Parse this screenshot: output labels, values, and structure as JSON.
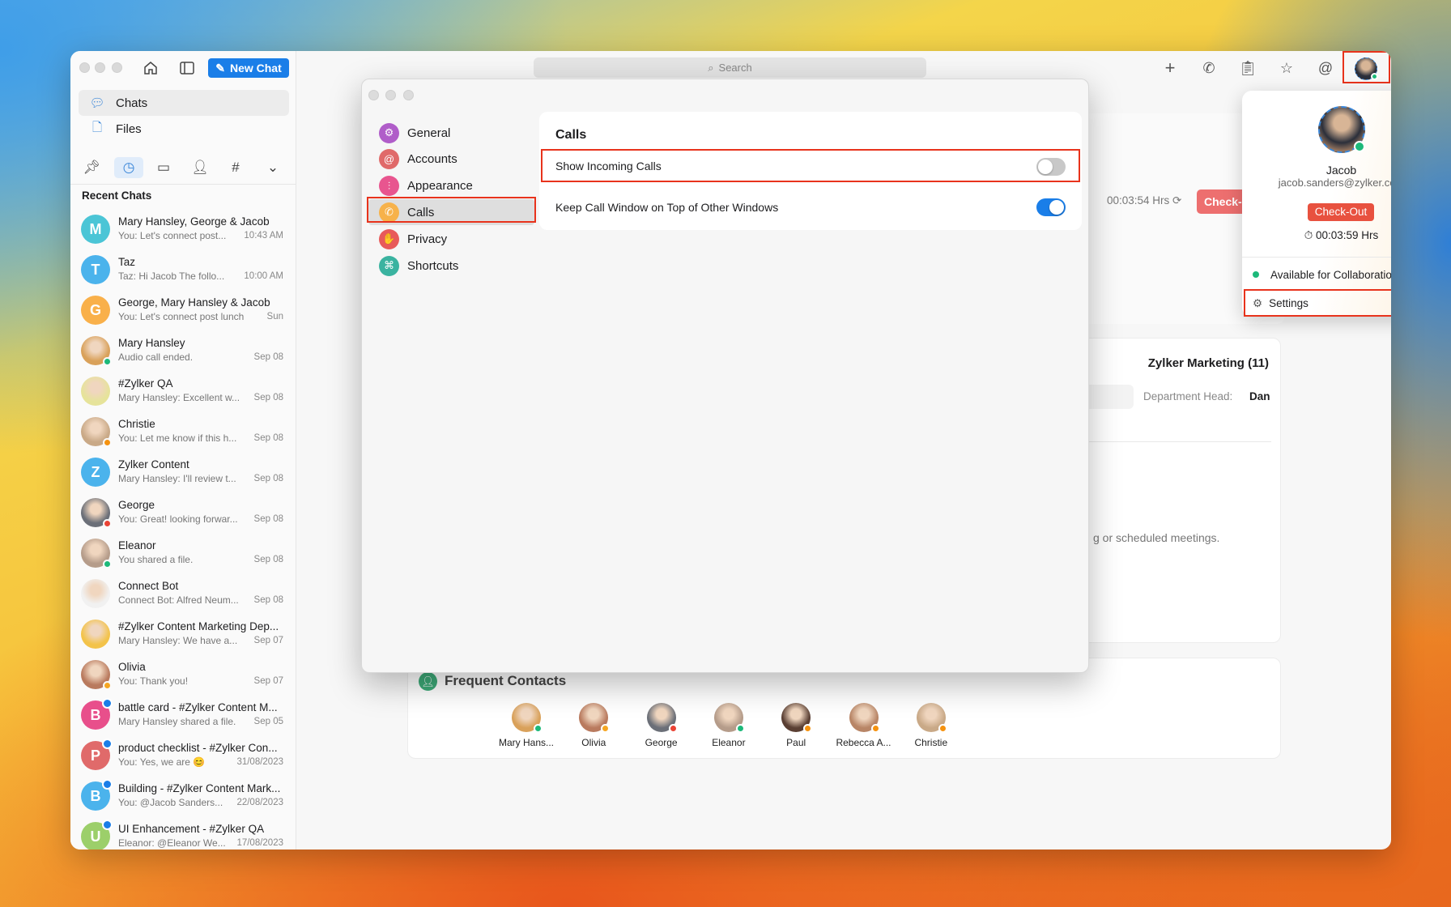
{
  "toolbar": {
    "new_chat": "New Chat",
    "search_placeholder": "Search"
  },
  "sidebar": {
    "nav": [
      {
        "label": "Chats",
        "icon": "chat-bubble-icon"
      },
      {
        "label": "Files",
        "icon": "file-icon"
      }
    ],
    "filters": [
      "pin-icon",
      "clock-icon",
      "chat-unread-icon",
      "contact-icon",
      "channel-hash-icon",
      "more-chevron-icon"
    ],
    "section_title": "Recent Chats",
    "chats": [
      {
        "name": "Mary Hansley, George & Jacob",
        "msg": "You: Let's connect post...",
        "time": "10:43 AM",
        "initial": "M",
        "color": "#4bc5d6"
      },
      {
        "name": "Taz",
        "msg": "Taz: Hi Jacob The follo...",
        "time": "10:00 AM",
        "initial": "T",
        "color": "#4bb3ec"
      },
      {
        "name": "George, Mary Hansley & Jacob",
        "msg": "You: Let's connect post lunch",
        "time": "Sun",
        "initial": "G",
        "color": "#f9b04a"
      },
      {
        "name": "Mary Hansley",
        "msg": "Audio call ended.",
        "time": "Sep 08",
        "photo": "#d9a15a",
        "status": "#1db97a"
      },
      {
        "name": "#Zylker QA",
        "msg": "Mary Hansley: Excellent w...",
        "time": "Sep 08",
        "photo": "#e6e39a"
      },
      {
        "name": "Christie",
        "msg": "You: Let me know if this h...",
        "time": "Sep 08",
        "photo": "#c9a987",
        "status": "#f5920f"
      },
      {
        "name": "Zylker Content",
        "msg": "Mary Hansley: I'll review t...",
        "time": "Sep 08",
        "initial": "Z",
        "color": "#4bb3ec"
      },
      {
        "name": "George",
        "msg": "You: Great! looking forwar...",
        "time": "Sep 08",
        "photo": "#6b6f78",
        "status": "#ea4335"
      },
      {
        "name": "Eleanor",
        "msg": "You shared a file.",
        "time": "Sep 08",
        "photo": "#b59c8a",
        "status": "#1db97a"
      },
      {
        "name": "Connect Bot",
        "msg": "Connect Bot: Alfred Neum...",
        "time": "Sep 08",
        "photo": "#f1f1f1"
      },
      {
        "name": "#Zylker Content Marketing Dep...",
        "msg": "Mary Hansley: We have a...",
        "time": "Sep 07",
        "photo": "#f3c34a"
      },
      {
        "name": "Olivia",
        "msg": "You: Thank you!",
        "time": "Sep 07",
        "photo": "#b97a5e",
        "status": "#f5a623"
      },
      {
        "name": "battle card - #Zylker Content M...",
        "msg": "Mary Hansley shared a file.",
        "time": "Sep 05",
        "initial": "B",
        "color": "#e84f8b",
        "badge": true
      },
      {
        "name": "product checklist - #Zylker Con...",
        "msg": "You: Yes, we are 😊",
        "time": "31/08/2023",
        "initial": "P",
        "color": "#e06a6a",
        "badge": true
      },
      {
        "name": "Building - #Zylker Content Mark...",
        "msg": "You: @Jacob Sanders...",
        "time": "22/08/2023",
        "initial": "B",
        "color": "#4bb3ec",
        "badge": true
      },
      {
        "name": "UI Enhancement - #Zylker QA",
        "msg": "Eleanor: @Eleanor We...",
        "time": "17/08/2023",
        "initial": "U",
        "color": "#9ccf6a",
        "badge": true
      }
    ]
  },
  "header_icons": [
    "plus-icon",
    "phone-icon",
    "clipboard-clock-icon",
    "star-icon",
    "mention-icon"
  ],
  "main": {
    "timer": "00:03:54 Hrs",
    "check_out": "Check-Out",
    "department": "Zylker Marketing (11)",
    "department_head_label": "Department Head:",
    "department_head_value": "Dan",
    "meetings_text": "g or scheduled meetings.",
    "frequent_title": "Frequent Contacts",
    "contacts": [
      {
        "name": "Mary Hans...",
        "photo": "#d9a15a",
        "status": "#1db97a"
      },
      {
        "name": "Olivia",
        "photo": "#b97a5e",
        "status": "#f5a623"
      },
      {
        "name": "George",
        "photo": "#6b6f78",
        "status": "#ea4335"
      },
      {
        "name": "Eleanor",
        "photo": "#b59c8a",
        "status": "#1db97a"
      },
      {
        "name": "Paul",
        "photo": "#5a3f33",
        "status": "#f5920f"
      },
      {
        "name": "Rebecca A...",
        "photo": "#b88566",
        "status": "#f5920f"
      },
      {
        "name": "Christie",
        "photo": "#c9a987",
        "status": "#f5920f"
      }
    ]
  },
  "settings": {
    "nav": [
      {
        "label": "General",
        "color": "#b05dc9",
        "glyph": "⚙"
      },
      {
        "label": "Accounts",
        "color": "#e06a6a",
        "glyph": "@"
      },
      {
        "label": "Appearance",
        "color": "#e8558f",
        "glyph": "⫶"
      },
      {
        "label": "Calls",
        "color": "#f7b24a",
        "glyph": "✆",
        "selected": true
      },
      {
        "label": "Privacy",
        "color": "#e85a5a",
        "glyph": "✋"
      },
      {
        "label": "Shortcuts",
        "color": "#3ab3a0",
        "glyph": "⌘"
      }
    ],
    "section_title": "Calls",
    "options": [
      {
        "label": "Show Incoming Calls",
        "on": false
      },
      {
        "label": "Keep Call Window on Top of Other Windows",
        "on": true
      }
    ]
  },
  "profile": {
    "name": "Jacob",
    "email": "jacob.sanders@zylker.com",
    "check_out": "Check-Out",
    "timer": "00:03:59 Hrs",
    "status": "Available for Collaboration",
    "status_color": "#1db97a",
    "settings": "Settings"
  },
  "colors": {
    "accent": "#1a7ee8",
    "danger": "#e8513f",
    "highlight": "#e8331c"
  }
}
